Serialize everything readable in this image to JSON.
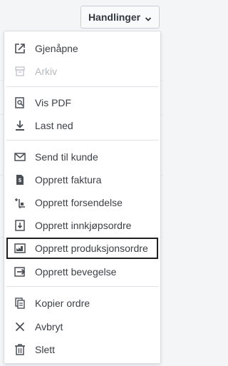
{
  "header": {
    "actions_label": "Handlinger",
    "caret_icon": "chevron-down-icon"
  },
  "menu": {
    "items": [
      {
        "id": "reopen",
        "label": "Gjenåpne",
        "icon": "external-link-icon",
        "disabled": false
      },
      {
        "id": "archive",
        "label": "Arkiv",
        "icon": "archive-icon",
        "disabled": true
      },
      {
        "id": "view-pdf",
        "label": "Vis PDF",
        "icon": "search-document-icon",
        "disabled": false
      },
      {
        "id": "download",
        "label": "Last ned",
        "icon": "download-icon",
        "disabled": false
      },
      {
        "id": "send",
        "label": "Send til kunde",
        "icon": "envelope-icon",
        "disabled": false
      },
      {
        "id": "invoice",
        "label": "Opprett faktura",
        "icon": "invoice-icon",
        "disabled": false
      },
      {
        "id": "shipment",
        "label": "Opprett forsendelse",
        "icon": "shipment-icon",
        "disabled": false
      },
      {
        "id": "purchase",
        "label": "Opprett innkjøpsordre",
        "icon": "purchase-order-icon",
        "disabled": false
      },
      {
        "id": "production",
        "label": "Opprett produksjonsordre",
        "icon": "production-order-icon",
        "disabled": false
      },
      {
        "id": "movement",
        "label": "Opprett bevegelse",
        "icon": "movement-icon",
        "disabled": false
      },
      {
        "id": "copy",
        "label": "Kopier ordre",
        "icon": "copy-icon",
        "disabled": false
      },
      {
        "id": "cancel",
        "label": "Avbryt",
        "icon": "close-icon",
        "disabled": false
      },
      {
        "id": "delete",
        "label": "Slett",
        "icon": "trash-icon",
        "disabled": false
      }
    ]
  },
  "colors": {
    "text": "#3b4046",
    "disabled": "#b3b8bf",
    "highlight_border": "#1f1f1f"
  }
}
